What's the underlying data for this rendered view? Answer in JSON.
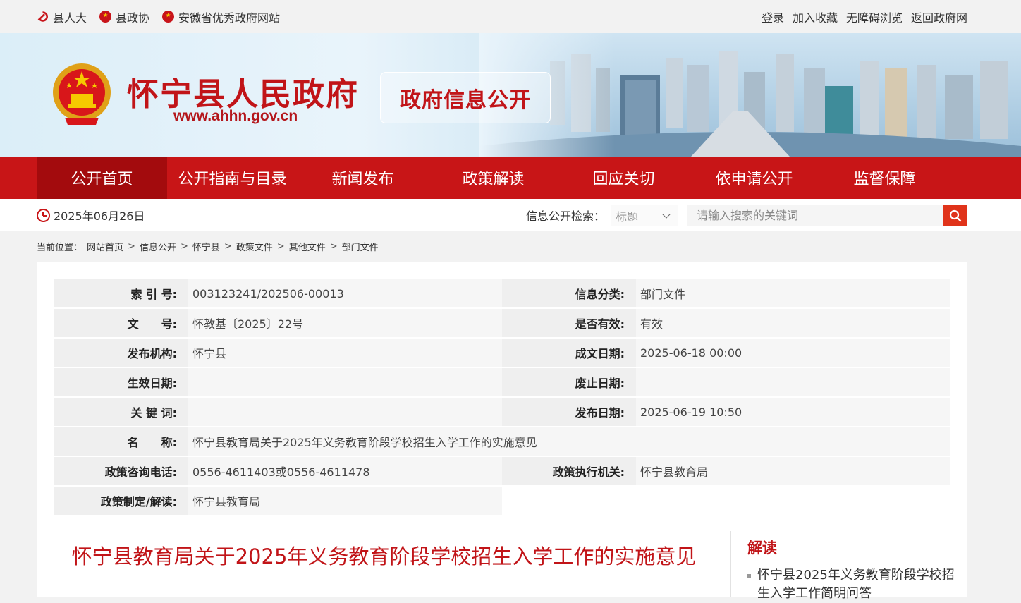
{
  "topbar": {
    "links": [
      "县人大",
      "县政协",
      "安徽省优秀政府网站"
    ],
    "right_links": [
      "登录",
      "加入收藏",
      "无障碍浏览",
      "返回政府网"
    ]
  },
  "banner": {
    "site_name": "怀宁县人民政府",
    "site_url": "www.ahhn.gov.cn",
    "section": "政府信息公开"
  },
  "nav": {
    "items": [
      "公开首页",
      "公开指南与目录",
      "新闻发布",
      "政策解读",
      "回应关切",
      "依申请公开",
      "监督保障"
    ]
  },
  "toolbar": {
    "date": "2025年06月26日",
    "search_label": "信息公开检索：",
    "select_value": "标题",
    "search_placeholder": "请输入搜索的关键词"
  },
  "breadcrumb": {
    "label": "当前位置：",
    "items": [
      "网站首页",
      "信息公开",
      "怀宁县",
      "政策文件",
      "其他文件",
      "部门文件"
    ]
  },
  "meta": {
    "index_label": "索 引 号:",
    "index_value": "003123241/202506-00013",
    "category_label": "信息分类:",
    "category_value": "部门文件",
    "docno_label": "文　　号:",
    "docno_value": "怀教基〔2025〕22号",
    "valid_label": "是否有效:",
    "valid_value": "有效",
    "issuer_label": "发布机构:",
    "issuer_value": "怀宁县",
    "created_label": "成文日期:",
    "created_value": "2025-06-18 00:00",
    "effective_label": "生效日期:",
    "effective_value": "",
    "abolish_label": "废止日期:",
    "abolish_value": "",
    "keywords_label": "关 键 词:",
    "keywords_value": "",
    "published_label": "发布日期:",
    "published_value": "2025-06-19 10:50",
    "name_label": "名　　称:",
    "name_value": "怀宁县教育局关于2025年义务教育阶段学校招生入学工作的实施意见",
    "phone_label": "政策咨询电话:",
    "phone_value": "0556-4611403或0556-4611478",
    "exec_label": "政策执行机关:",
    "exec_value": "怀宁县教育局",
    "interp_label": "政策制定/解读:",
    "interp_value": "怀宁县教育局"
  },
  "document": {
    "title": "怀宁县教育局关于2025年义务教育阶段学校招生入学工作的实施意见"
  },
  "sidebar": {
    "title": "解读",
    "item": "怀宁县2025年义务教育阶段学校招生入学工作简明问答"
  },
  "colors": {
    "brand_red": "#c81517",
    "title_red": "#c11418",
    "search_btn": "#e0331a"
  }
}
